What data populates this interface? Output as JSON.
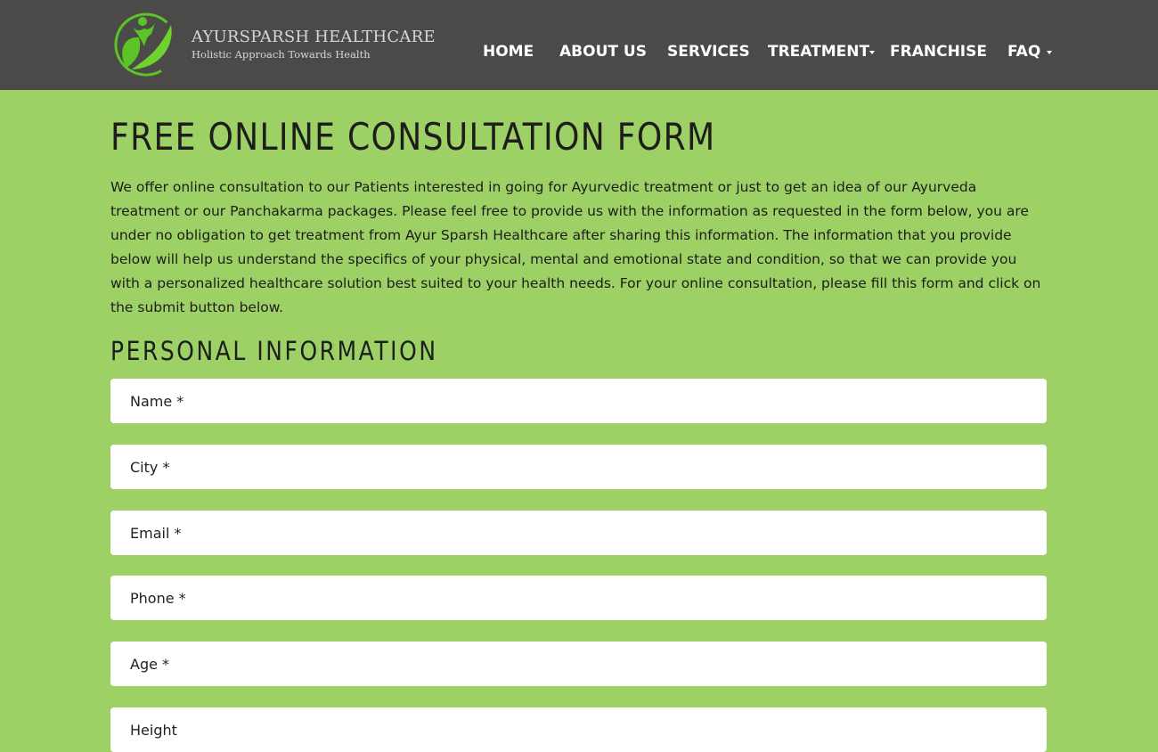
{
  "brand": {
    "name": "AYURSPARSH HEALTHCARE",
    "tagline": "Holistic Approach Towards Health",
    "logo_icon": "leaf-person-logo-icon",
    "colors": {
      "header_bg": "#4b4a48",
      "page_bg": "#9dd166",
      "logo_green": "#5cc427"
    }
  },
  "nav": {
    "items": [
      {
        "label": "HOME"
      },
      {
        "label": "ABOUT US"
      },
      {
        "label": "SERVICES"
      },
      {
        "label": "TREATMENT",
        "has_dropdown": true
      },
      {
        "label": "FRANCHISE"
      },
      {
        "label": "FAQ",
        "has_dropdown": true
      }
    ]
  },
  "main": {
    "title": "FREE ONLINE CONSULTATION FORM",
    "intro": "We offer online consultation to our Patients interested in going for Ayurvedic treatment or just to get an idea of our Ayurveda treatment or our Panchakarma packages. Please feel free to provide us with the information as requested in the form below, you are under no obligation to get treatment from Ayur Sparsh Healthcare after sharing this information. The information that you provide below will help us understand the specifics of your physical, mental and emotional state and condition, so that we can provide you with a personalized healthcare solution best suited to your health needs. For your online consultation, please fill this form and click on the submit button below.",
    "section_title": "PERSONAL INFORMATION",
    "fields": [
      {
        "placeholder": "Name *",
        "value": ""
      },
      {
        "placeholder": "City *",
        "value": ""
      },
      {
        "placeholder": "Email *",
        "value": ""
      },
      {
        "placeholder": "Phone *",
        "value": ""
      },
      {
        "placeholder": "Age *",
        "value": ""
      },
      {
        "placeholder": "Height",
        "value": ""
      }
    ]
  }
}
